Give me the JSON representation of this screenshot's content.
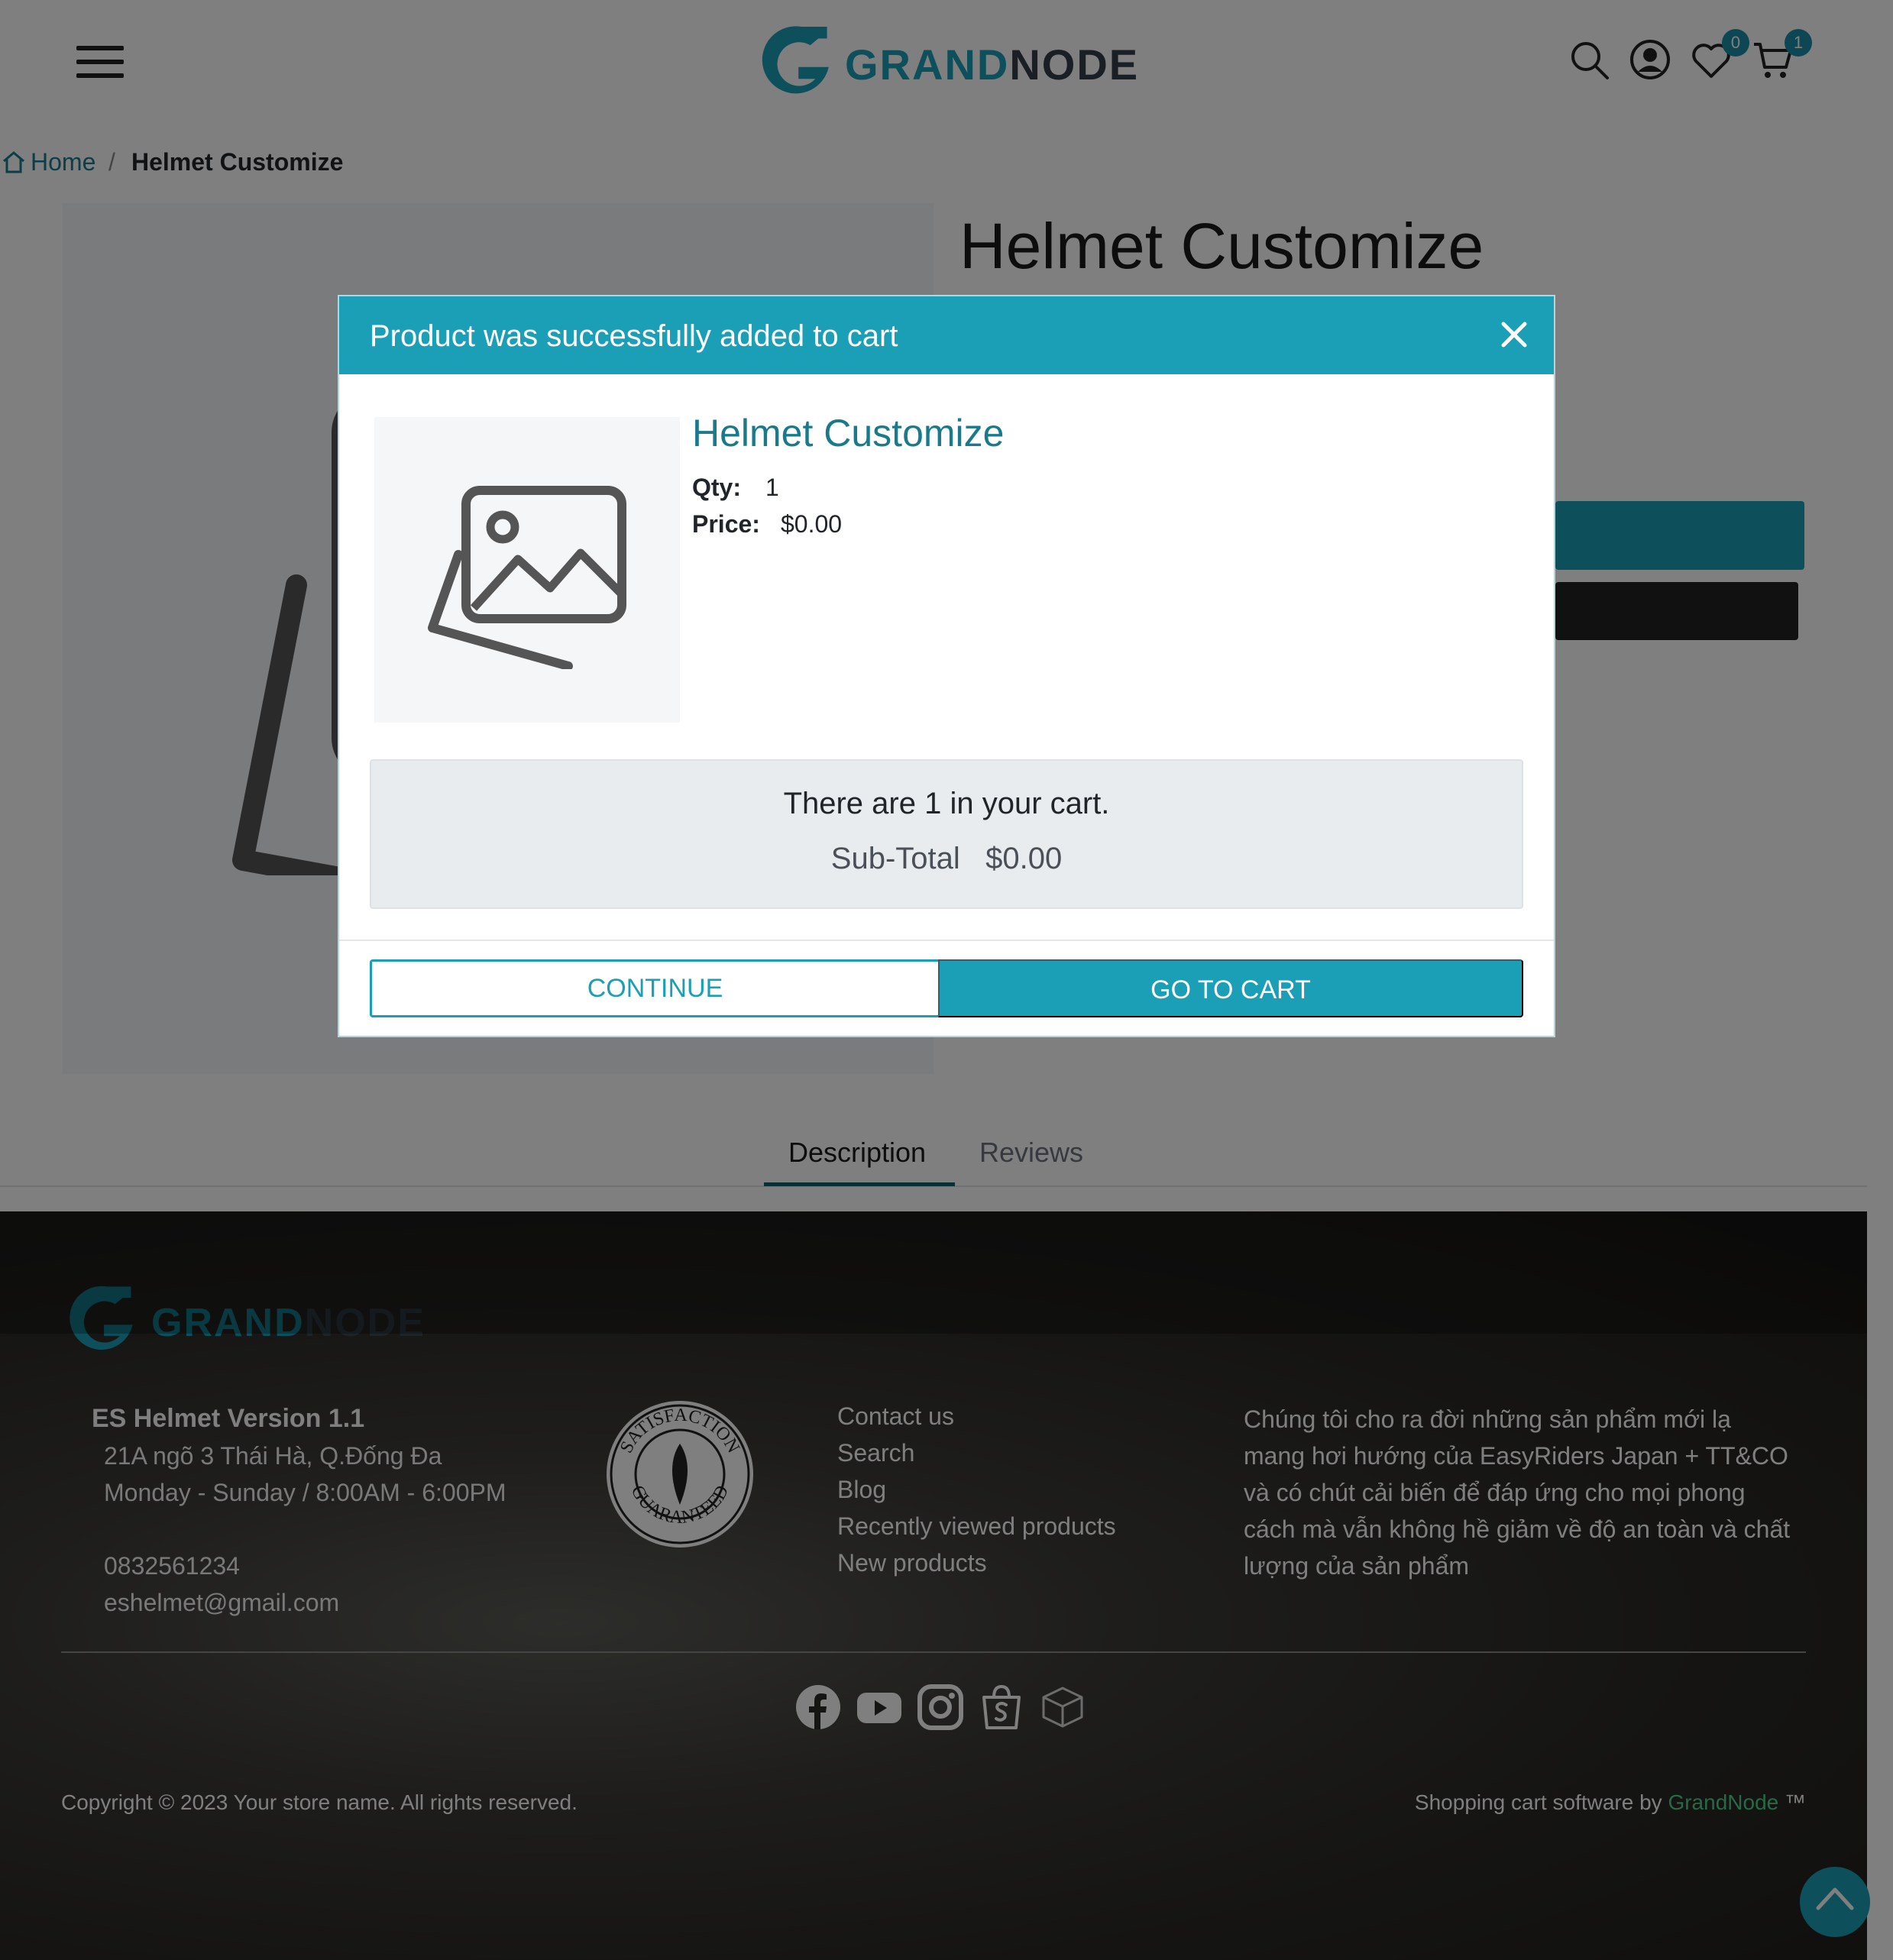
{
  "header": {
    "logo_text_a": "GRAND",
    "logo_text_b": "NODE",
    "wishlist_count": "0",
    "cart_count": "1"
  },
  "breadcrumb": {
    "home": "Home",
    "separator": "/",
    "current": "Helmet Customize"
  },
  "product": {
    "title": "Helmet Customize"
  },
  "tabs": [
    {
      "label": "Description"
    },
    {
      "label": "Reviews"
    }
  ],
  "modal": {
    "title": "Product was successfully added to cart",
    "product_name": "Helmet Customize",
    "qty_label": "Qty:",
    "qty_value": "1",
    "price_label": "Price:",
    "price_value": "$0.00",
    "cart_summary": "There are 1 in your cart.",
    "subtotal_label": "Sub-Total",
    "subtotal_value": "$0.00",
    "continue_label": "CONTINUE",
    "go_to_cart_label": "GO TO CART"
  },
  "footer": {
    "logo_text_a": "GRAND",
    "logo_text_b": "NODE",
    "store_title": "ES Helmet Version 1.1",
    "address": "21A ngõ 3 Thái Hà, Q.Đống Đa",
    "hours": "Monday - Sunday / 8:00AM - 6:00PM",
    "phone": "0832561234",
    "email": "eshelmet@gmail.com",
    "seal_top": "SATISFACTION",
    "seal_bottom": "GUARANTEED",
    "links": [
      "Contact us",
      "Search",
      "Blog",
      "Recently viewed products",
      "New products"
    ],
    "about": "Chúng tôi cho ra đời những sản phẩm mới lạ mang hơi hướng của EasyRiders Japan + TT&CO và có chút cải biến để đáp ứng cho mọi phong cách mà vẫn không hề giảm về độ an toàn và chất lượng của sản phẩm",
    "copyright": "Copyright © 2023 Your store name. All rights reserved.",
    "powered_prefix": "Shopping cart software by",
    "powered_link": "GrandNode",
    "powered_suffix": "™"
  },
  "colors": {
    "accent": "#1a9fb6",
    "accent_dark": "#1a7a8c",
    "powered_link": "#4cd48a"
  }
}
